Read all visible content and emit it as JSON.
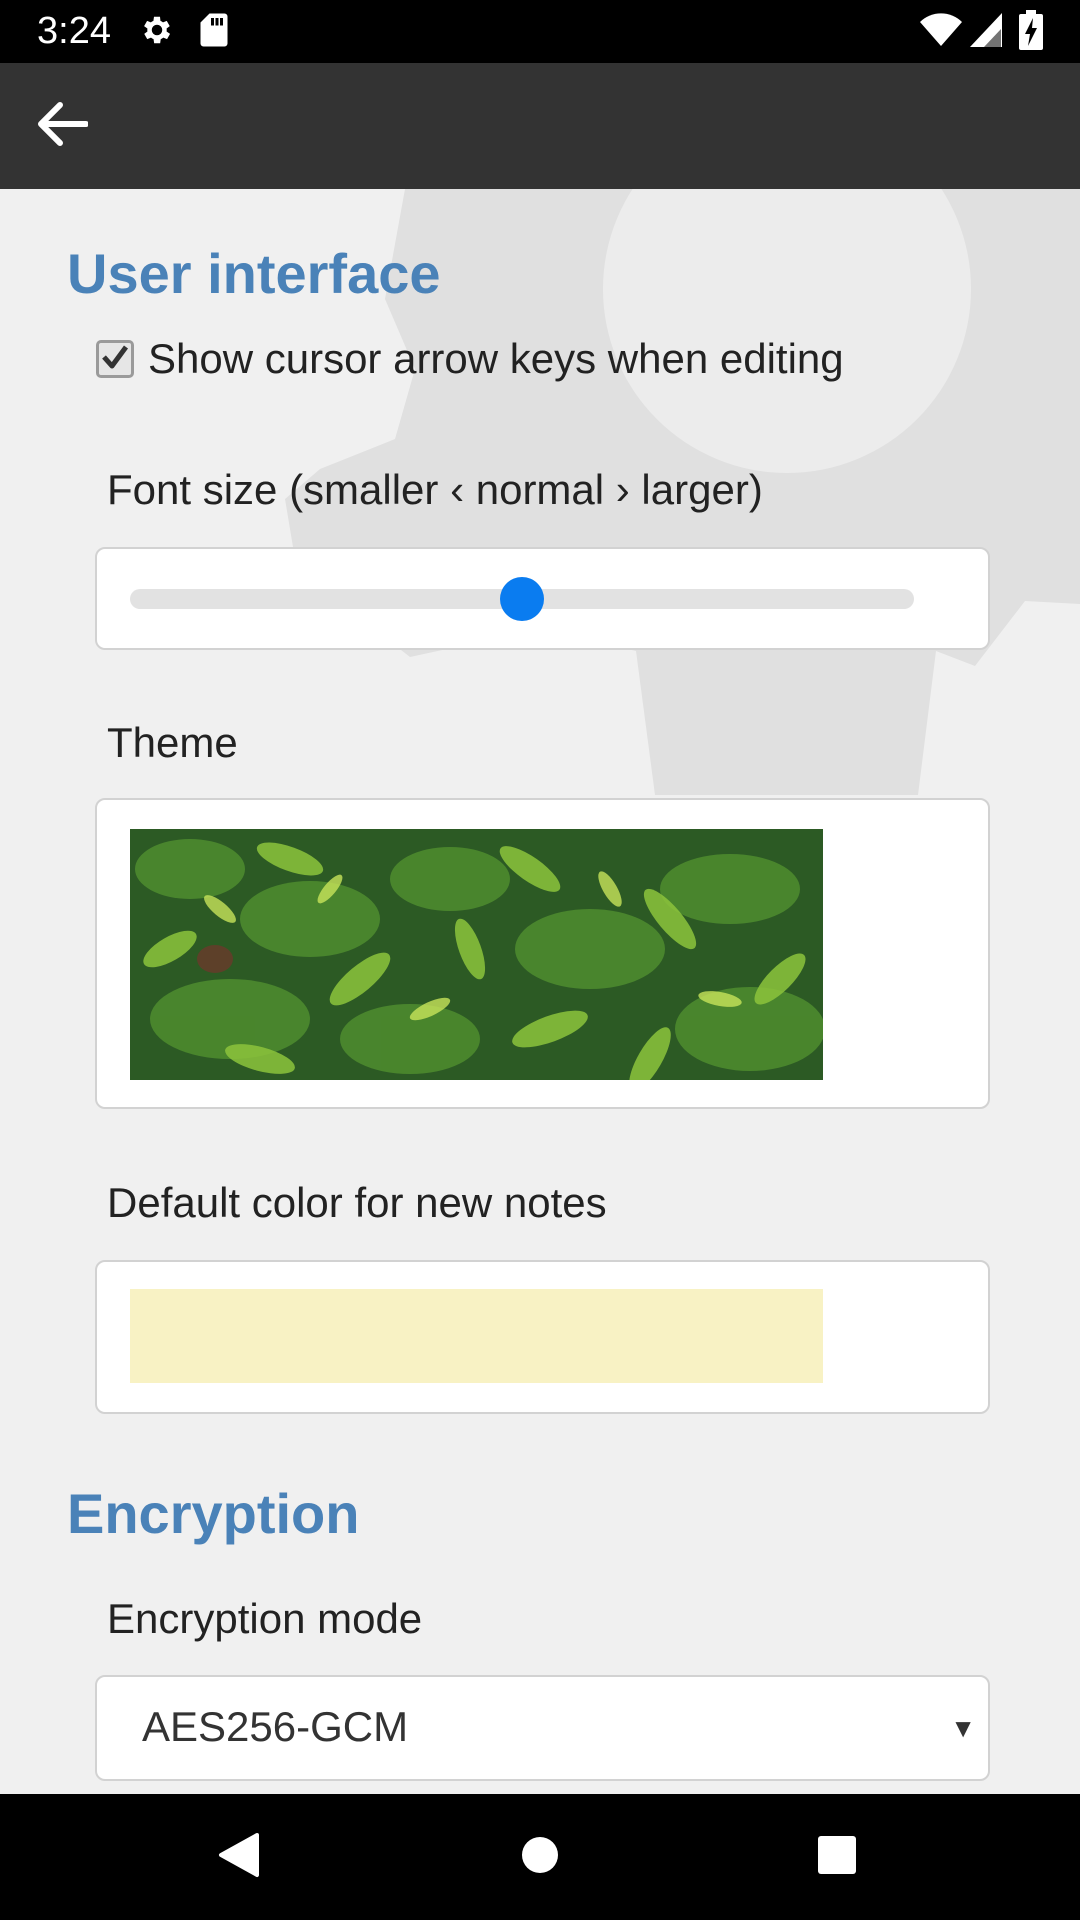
{
  "status_bar": {
    "time": "3:24",
    "left_icons": [
      "gear-icon",
      "sd-card-icon"
    ],
    "right_icons": [
      "wifi-icon",
      "signal-icon",
      "battery-charging-icon"
    ]
  },
  "app_bar": {
    "back_icon": "arrow-left-icon"
  },
  "user_interface": {
    "title": "User interface",
    "show_cursor_keys": {
      "label": "Show cursor arrow keys when editing",
      "checked": true
    },
    "font_size": {
      "label": "Font size (smaller ‹ normal › larger)",
      "value": 0.5
    },
    "theme": {
      "label": "Theme",
      "image": "green-leaves-photo"
    },
    "default_color": {
      "label": "Default color for new notes",
      "color": "#f8f2c4"
    }
  },
  "encryption": {
    "title": "Encryption",
    "mode": {
      "label": "Encryption mode",
      "value": "AES256-GCM"
    }
  },
  "nav_bar": {
    "icons": [
      "back-triangle-icon",
      "home-circle-icon",
      "recents-square-icon"
    ]
  },
  "colors": {
    "section_title": "#4a82b8",
    "slider_thumb": "#0a7cf0",
    "app_bar": "#333333",
    "background": "#f0f0f0"
  }
}
